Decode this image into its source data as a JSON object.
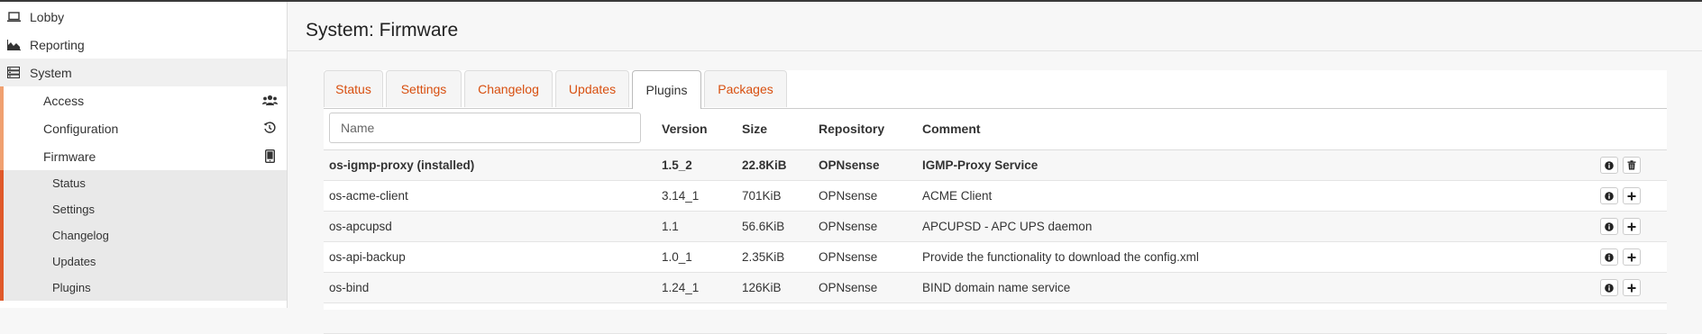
{
  "sidebar": {
    "items": [
      {
        "label": "Lobby",
        "icon": "laptop-icon"
      },
      {
        "label": "Reporting",
        "icon": "area-chart-icon"
      },
      {
        "label": "System",
        "icon": "server-icon"
      },
      {
        "label": "Access",
        "icon": "users-icon"
      },
      {
        "label": "Configuration",
        "icon": "history-icon"
      },
      {
        "label": "Firmware",
        "icon": "tablet-icon"
      },
      {
        "label": "Status"
      },
      {
        "label": "Settings"
      },
      {
        "label": "Changelog"
      },
      {
        "label": "Updates"
      },
      {
        "label": "Plugins"
      }
    ]
  },
  "page": {
    "title": "System: Firmware"
  },
  "tabs": [
    {
      "label": "Status"
    },
    {
      "label": "Settings"
    },
    {
      "label": "Changelog"
    },
    {
      "label": "Updates"
    },
    {
      "label": "Plugins",
      "active": true
    },
    {
      "label": "Packages"
    }
  ],
  "table": {
    "search_placeholder": "Name",
    "headers": {
      "version": "Version",
      "size": "Size",
      "repository": "Repository",
      "comment": "Comment"
    },
    "rows": [
      {
        "name": "os-igmp-proxy (installed)",
        "version": "1.5_2",
        "size": "22.8KiB",
        "repository": "OPNsense",
        "comment": "IGMP-Proxy Service",
        "installed": true
      },
      {
        "name": "os-acme-client",
        "version": "3.14_1",
        "size": "701KiB",
        "repository": "OPNsense",
        "comment": "ACME Client"
      },
      {
        "name": "os-apcupsd",
        "version": "1.1",
        "size": "56.6KiB",
        "repository": "OPNsense",
        "comment": "APCUPSD - APC UPS daemon"
      },
      {
        "name": "os-api-backup",
        "version": "1.0_1",
        "size": "2.35KiB",
        "repository": "OPNsense",
        "comment": "Provide the functionality to download the config.xml"
      },
      {
        "name": "os-bind",
        "version": "1.24_1",
        "size": "126KiB",
        "repository": "OPNsense",
        "comment": "BIND domain name service"
      }
    ]
  },
  "colors": {
    "accent": "#d84f0f",
    "sidebar_active_bar": "#e0592a"
  }
}
